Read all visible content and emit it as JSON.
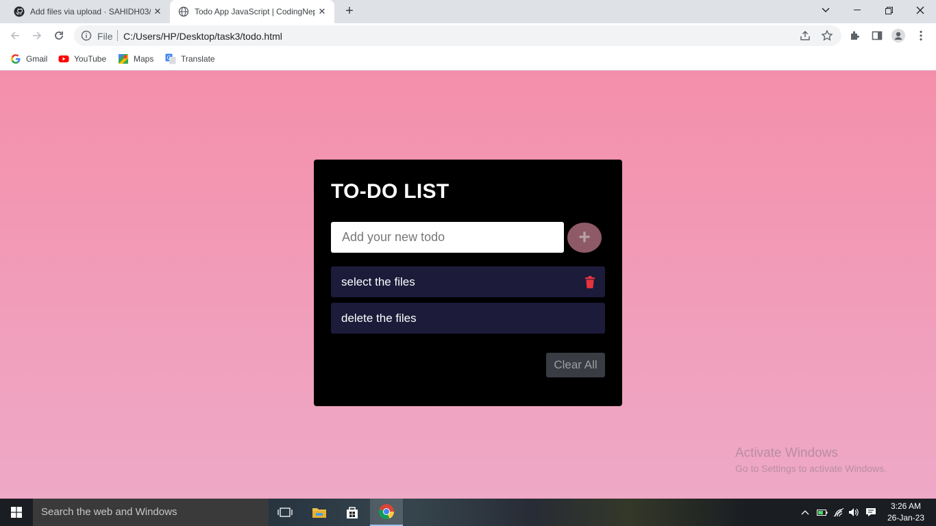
{
  "browser": {
    "tabs": [
      {
        "title": "Add files via upload · SAHIDH03/",
        "icon": "github-icon",
        "active": false
      },
      {
        "title": "Todo App JavaScript | CodingNep",
        "icon": "globe-icon",
        "active": true
      }
    ],
    "omnibox": {
      "scheme_label": "File",
      "url": "C:/Users/HP/Desktop/task3/todo.html"
    },
    "bookmarks": [
      {
        "label": "Gmail",
        "icon": "google-icon"
      },
      {
        "label": "YouTube",
        "icon": "youtube-icon"
      },
      {
        "label": "Maps",
        "icon": "maps-icon"
      },
      {
        "label": "Translate",
        "icon": "translate-icon"
      }
    ]
  },
  "app": {
    "title": "TO-DO LIST",
    "input_placeholder": "Add your new todo",
    "add_button": "+",
    "todos": [
      {
        "text": "select the files",
        "show_delete": true
      },
      {
        "text": "delete the files",
        "show_delete": false
      }
    ],
    "clear_button": "Clear All",
    "colors": {
      "card": "#000000",
      "item": "#1c1b3a",
      "delete": "#e8343d",
      "background_top": "#f48fab",
      "background_bottom": "#eea9c6"
    }
  },
  "watermark": {
    "line1": "Activate Windows",
    "line2": "Go to Settings to activate Windows."
  },
  "taskbar": {
    "search_placeholder": "Search the web and Windows",
    "time": "3:26 AM",
    "date": "26-Jan-23"
  }
}
